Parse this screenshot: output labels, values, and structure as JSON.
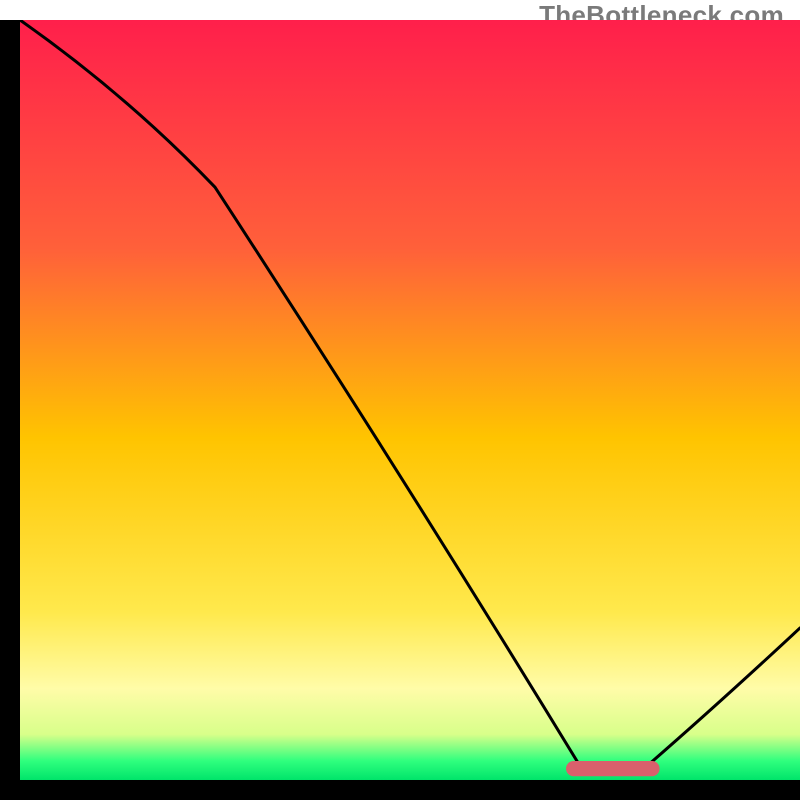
{
  "watermark": "TheBottleneck.com",
  "chart_data": {
    "type": "line",
    "title": "",
    "xlabel": "",
    "ylabel": "",
    "xlim": [
      0,
      100
    ],
    "ylim": [
      0,
      100
    ],
    "x": [
      0,
      25,
      72,
      80,
      100
    ],
    "values": [
      100,
      78,
      1.5,
      1.5,
      20
    ],
    "curve_note": "Black curve descends from top-left, gentle kink ~x=25, then steep nearly-linear drop to a flat minimum around x=72–80, then rises toward x=100.",
    "axes": {
      "left_edge_black": true,
      "bottom_edge_black": true,
      "left_thickness_pct": 2.5,
      "bottom_thickness_pct": 2.5
    },
    "background_gradient": {
      "direction": "vertical",
      "stops": [
        {
          "pos": 0.0,
          "color": "#ff1f4b"
        },
        {
          "pos": 0.3,
          "color": "#ff603a"
        },
        {
          "pos": 0.55,
          "color": "#ffc400"
        },
        {
          "pos": 0.78,
          "color": "#ffe94d"
        },
        {
          "pos": 0.88,
          "color": "#fffca8"
        },
        {
          "pos": 0.94,
          "color": "#d8ff8a"
        },
        {
          "pos": 0.975,
          "color": "#2fff7e"
        },
        {
          "pos": 1.0,
          "color": "#00e46a"
        }
      ]
    },
    "marker": {
      "shape": "rounded-bar",
      "x_center_pct": 76,
      "y_center_pct": 1.5,
      "width_pct": 12,
      "height_pct": 2,
      "color": "#d9606c"
    }
  }
}
